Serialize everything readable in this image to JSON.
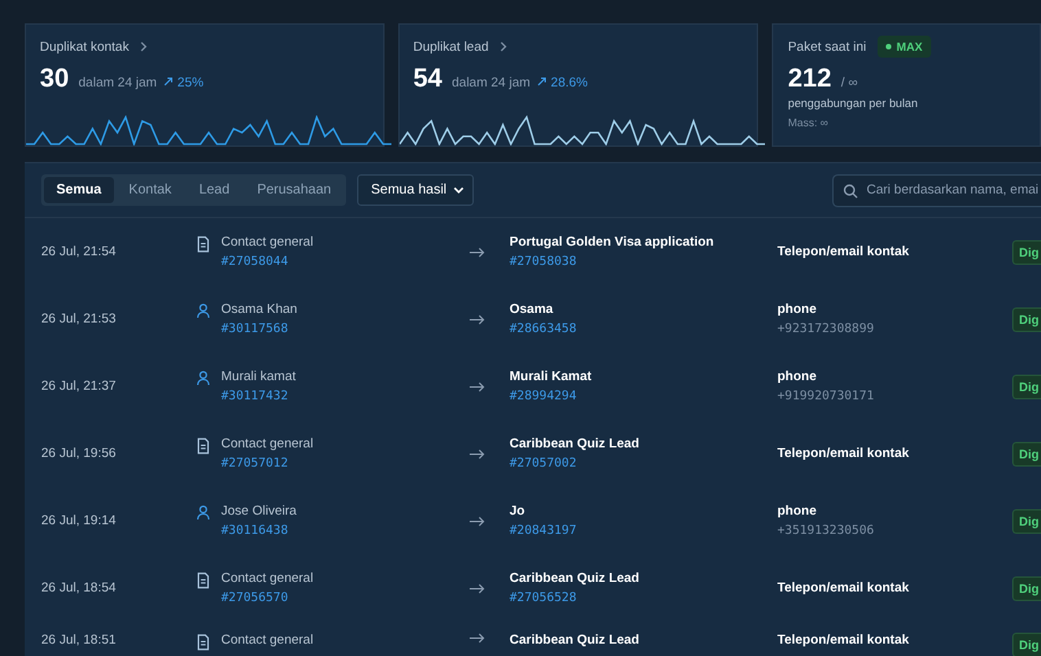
{
  "stats": [
    {
      "title": "Duplikat kontak",
      "value": "30",
      "period": "dalam 24 jam",
      "change": "25%"
    },
    {
      "title": "Duplikat lead",
      "value": "54",
      "period": "dalam 24 jam",
      "change": "28.6%"
    }
  ],
  "plan": {
    "title": "Paket saat ini",
    "badge": "MAX",
    "value": "212",
    "limit": "/ ∞",
    "caption": "penggabungan per bulan",
    "mass": "Mass: ∞"
  },
  "tabs": [
    {
      "label": "Semua",
      "selected": true
    },
    {
      "label": "Kontak",
      "selected": false
    },
    {
      "label": "Lead",
      "selected": false
    },
    {
      "label": "Perusahaan",
      "selected": false
    }
  ],
  "filter": {
    "value": "Semua hasil"
  },
  "search": {
    "placeholder": "Cari berdasarkan nama, emai"
  },
  "rows": [
    {
      "date": "26 Jul, 21:54",
      "source": {
        "kind": "form",
        "name": "Contact general",
        "id": "#27058044"
      },
      "target": {
        "name": "Portugal Golden Visa application",
        "id": "#27058038"
      },
      "method": {
        "label": "Telepon/email kontak"
      },
      "status": "Dig"
    },
    {
      "date": "26 Jul, 21:53",
      "source": {
        "kind": "contact",
        "name": "Osama Khan",
        "id": "#30117568"
      },
      "target": {
        "name": "Osama",
        "id": "#28663458"
      },
      "method": {
        "label": "phone",
        "detail": "+923172308899"
      },
      "status": "Dig"
    },
    {
      "date": "26 Jul, 21:37",
      "source": {
        "kind": "contact",
        "name": "Murali kamat",
        "id": "#30117432"
      },
      "target": {
        "name": "Murali Kamat",
        "id": "#28994294"
      },
      "method": {
        "label": "phone",
        "detail": "+919920730171"
      },
      "status": "Dig"
    },
    {
      "date": "26 Jul, 19:56",
      "source": {
        "kind": "form",
        "name": "Contact general",
        "id": "#27057012"
      },
      "target": {
        "name": "Caribbean Quiz Lead",
        "id": "#27057002"
      },
      "method": {
        "label": "Telepon/email kontak"
      },
      "status": "Dig"
    },
    {
      "date": "26 Jul, 19:14",
      "source": {
        "kind": "contact",
        "name": "Jose Oliveira",
        "id": "#30116438"
      },
      "target": {
        "name": "Jo",
        "id": "#20843197"
      },
      "method": {
        "label": "phone",
        "detail": "+351913230506"
      },
      "status": "Dig"
    },
    {
      "date": "26 Jul, 18:54",
      "source": {
        "kind": "form",
        "name": "Contact general",
        "id": "#27056570"
      },
      "target": {
        "name": "Caribbean Quiz Lead",
        "id": "#27056528"
      },
      "method": {
        "label": "Telepon/email kontak"
      },
      "status": "Dig"
    },
    {
      "date": "26 Jul, 18:51",
      "source": {
        "kind": "form",
        "name": "Contact general"
      },
      "target": {
        "name": "Caribbean Quiz Lead"
      },
      "method": {
        "label": "Telepon/email kontak"
      },
      "status": "Dig"
    }
  ]
}
